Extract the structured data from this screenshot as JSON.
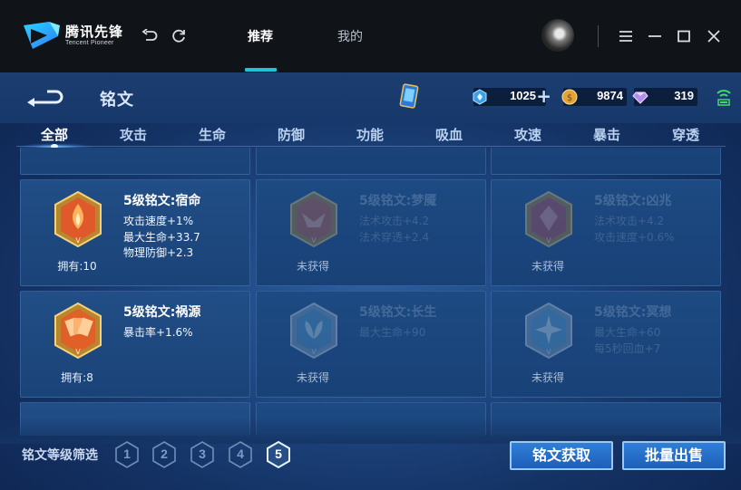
{
  "titlebar": {
    "brand_cn": "腾讯先锋",
    "brand_en": "Tencent Pioneer",
    "nav_tabs": [
      {
        "label": "推荐",
        "active": true
      },
      {
        "label": "我的",
        "active": false
      }
    ],
    "icons": [
      "undo-icon",
      "refresh-icon",
      "menu-icon",
      "minimize-icon",
      "maximize-icon",
      "close-icon"
    ]
  },
  "game": {
    "title": "铭文",
    "currencies": [
      {
        "name": "diamond-coupon",
        "value": "1025",
        "color": "#3aa0e6"
      },
      {
        "name": "gold",
        "value": "9874",
        "color": "#e0a43a"
      },
      {
        "name": "crystal",
        "value": "319",
        "color": "#b48cf0"
      }
    ],
    "tabs": [
      {
        "label": "全部",
        "active": true
      },
      {
        "label": "攻击"
      },
      {
        "label": "生命"
      },
      {
        "label": "防御"
      },
      {
        "label": "功能"
      },
      {
        "label": "吸血"
      },
      {
        "label": "攻速"
      },
      {
        "label": "暴击"
      },
      {
        "label": "穿透"
      }
    ],
    "runes": [
      {
        "name": "5级铭文:宿命",
        "stats": [
          "攻击速度+1%",
          "最大生命+33.7",
          "物理防御+2.3"
        ],
        "owned": "拥有:10",
        "locked": false,
        "color": "#e0592a"
      },
      {
        "name": "5级铭文:梦魇",
        "stats": [
          "法术攻击+4.2",
          "法术穿透+2.4"
        ],
        "owned": "未获得",
        "locked": true,
        "color": "#d86040"
      },
      {
        "name": "5级铭文:凶兆",
        "stats": [
          "法术攻击+4.2",
          "攻击速度+0.6%"
        ],
        "owned": "未获得",
        "locked": true,
        "color": "#c85050"
      },
      {
        "name": "5级铭文:祸源",
        "stats": [
          "暴击率+1.6%"
        ],
        "owned": "拥有:8",
        "locked": false,
        "color": "#e06028"
      },
      {
        "name": "5级铭文:长生",
        "stats": [
          "最大生命+90"
        ],
        "owned": "未获得",
        "locked": true,
        "color": "#5aa0d0"
      },
      {
        "name": "5级铭文:冥想",
        "stats": [
          "最大生命+60",
          "每5秒回血+7"
        ],
        "owned": "未获得",
        "locked": true,
        "color": "#60a8d8"
      }
    ],
    "filter_label": "铭文等级筛选",
    "levels": [
      "1",
      "2",
      "3",
      "4",
      "5"
    ],
    "selected_level": "5",
    "buttons": {
      "obtain": "铭文获取",
      "sell": "批量出售"
    }
  }
}
